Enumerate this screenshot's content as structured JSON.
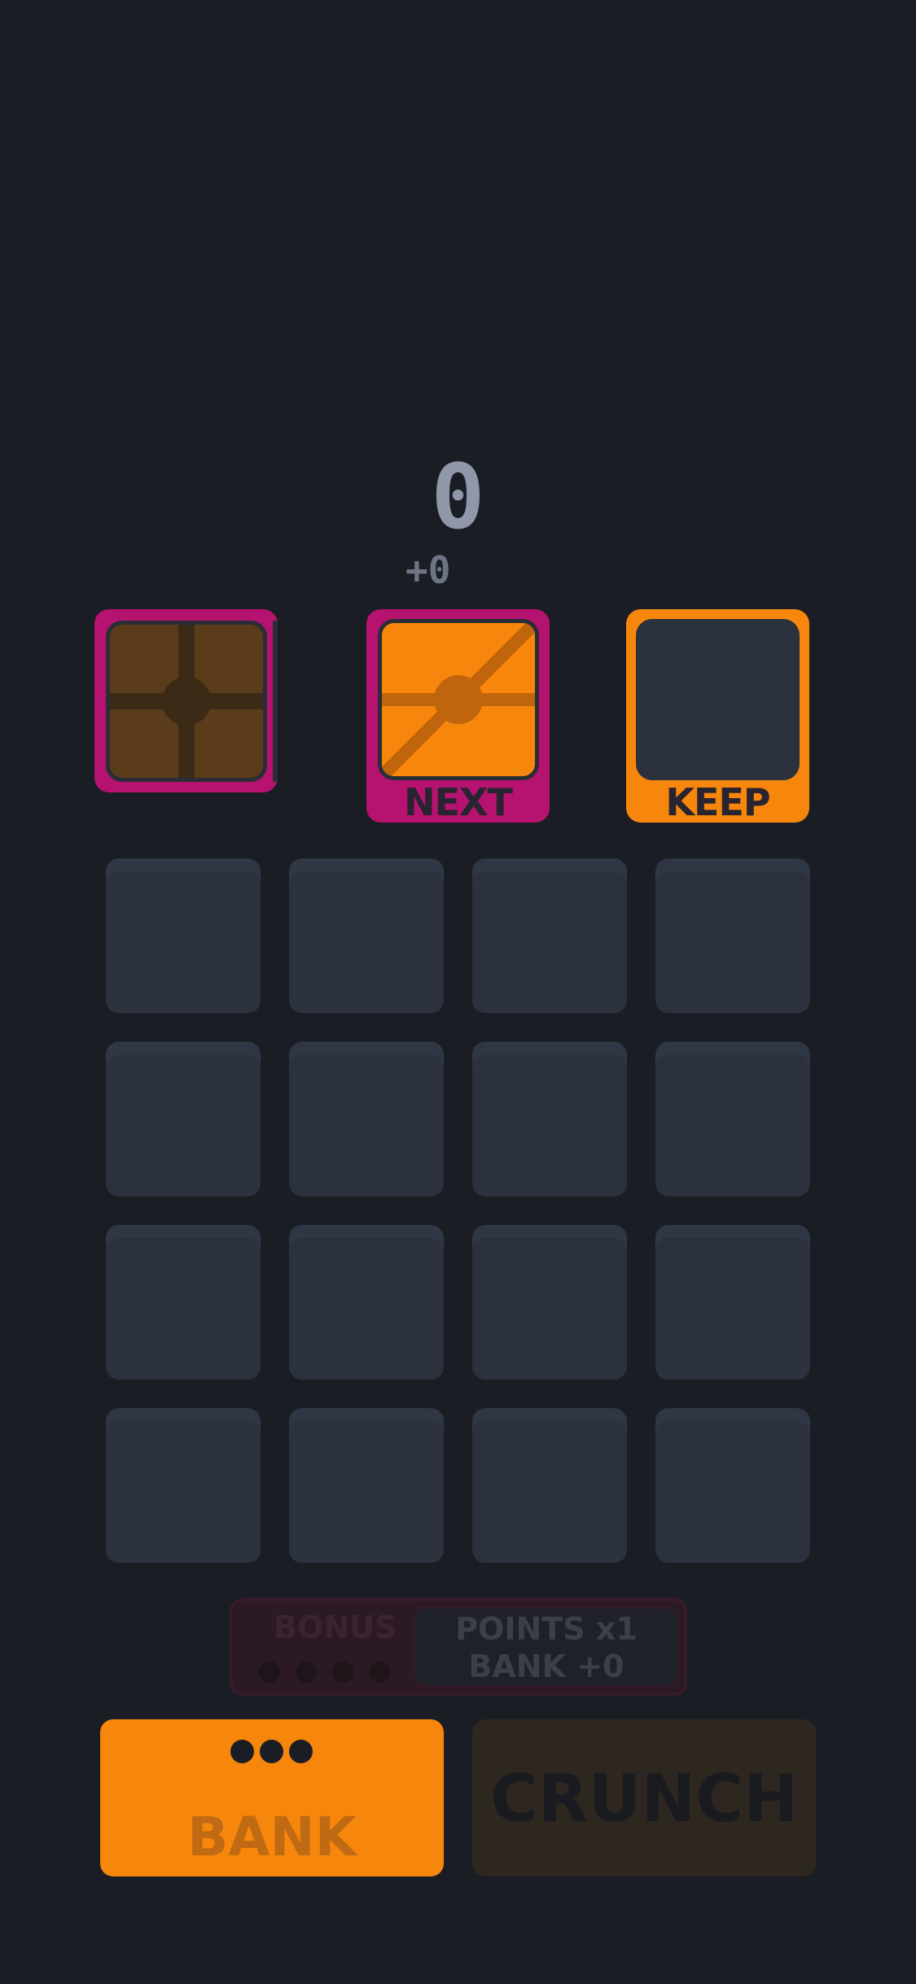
{
  "score": {
    "value": "0",
    "delta": "+0"
  },
  "slots": {
    "held": {
      "tile": "cross-tile-dim"
    },
    "next": {
      "label": "NEXT",
      "tile": "diagonal-cross-tile"
    },
    "keep": {
      "label": "KEEP"
    }
  },
  "grid": {
    "rows": 4,
    "cols": 4,
    "cells": [
      [
        null,
        null,
        null,
        null
      ],
      [
        null,
        null,
        null,
        null
      ],
      [
        null,
        null,
        null,
        null
      ],
      [
        null,
        null,
        null,
        null
      ]
    ]
  },
  "bonus": {
    "label": "BONUS",
    "points": "POINTS x1",
    "bank": "BANK +0",
    "dots_filled": 0,
    "dots_total": 4
  },
  "buttons": {
    "bank": {
      "label": "BANK",
      "charges": 3
    },
    "crunch": {
      "label": "CRUNCH"
    }
  },
  "colors": {
    "background": "#1b1d24",
    "magenta": "#b5136f",
    "orange": "#f7870c",
    "cell": "#2b313d"
  }
}
